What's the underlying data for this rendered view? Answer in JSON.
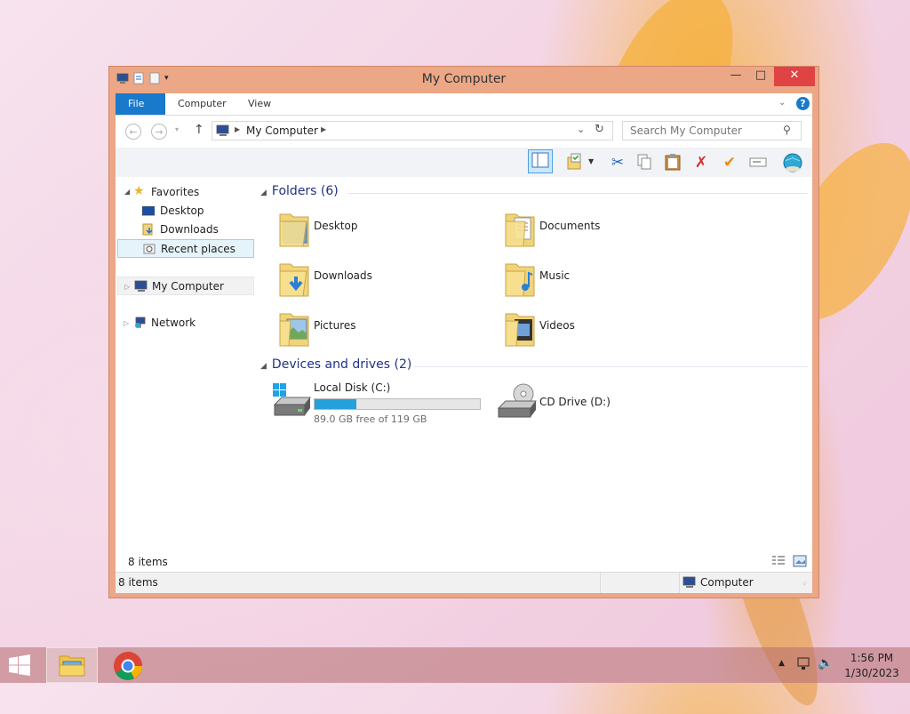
{
  "window": {
    "title": "My Computer",
    "minimize": "—",
    "maximize": "□",
    "close": "✕"
  },
  "ribbon": {
    "tabs": [
      "File",
      "Computer",
      "View"
    ],
    "help": "?"
  },
  "address": {
    "path": "My Computer",
    "search_placeholder": "Search My Computer"
  },
  "nav_pane": {
    "favorites": "Favorites",
    "favorites_items": [
      "Desktop",
      "Downloads",
      "Recent places"
    ],
    "computer": "My Computer",
    "network": "Network"
  },
  "folders": {
    "header": "Folders (6)",
    "items": [
      "Desktop",
      "Documents",
      "Downloads",
      "Music",
      "Pictures",
      "Videos"
    ]
  },
  "devices": {
    "header": "Devices and drives (2)",
    "local_disk": {
      "name": "Local Disk (C:)",
      "free_text": "89.0 GB free of 119 GB",
      "used_fraction": 0.252
    },
    "cd_drive": {
      "name": "CD Drive (D:)"
    }
  },
  "status": {
    "inner_count": "8 items",
    "count": "8 items",
    "location": "Computer"
  },
  "taskbar": {
    "time": "1:56 PM",
    "date": "1/30/2023"
  },
  "colors": {
    "frame": "#eba786",
    "file_tab": "#1979ca",
    "close_button": "#e04343",
    "progress": "#26a0da",
    "group_header": "#1e3287"
  }
}
